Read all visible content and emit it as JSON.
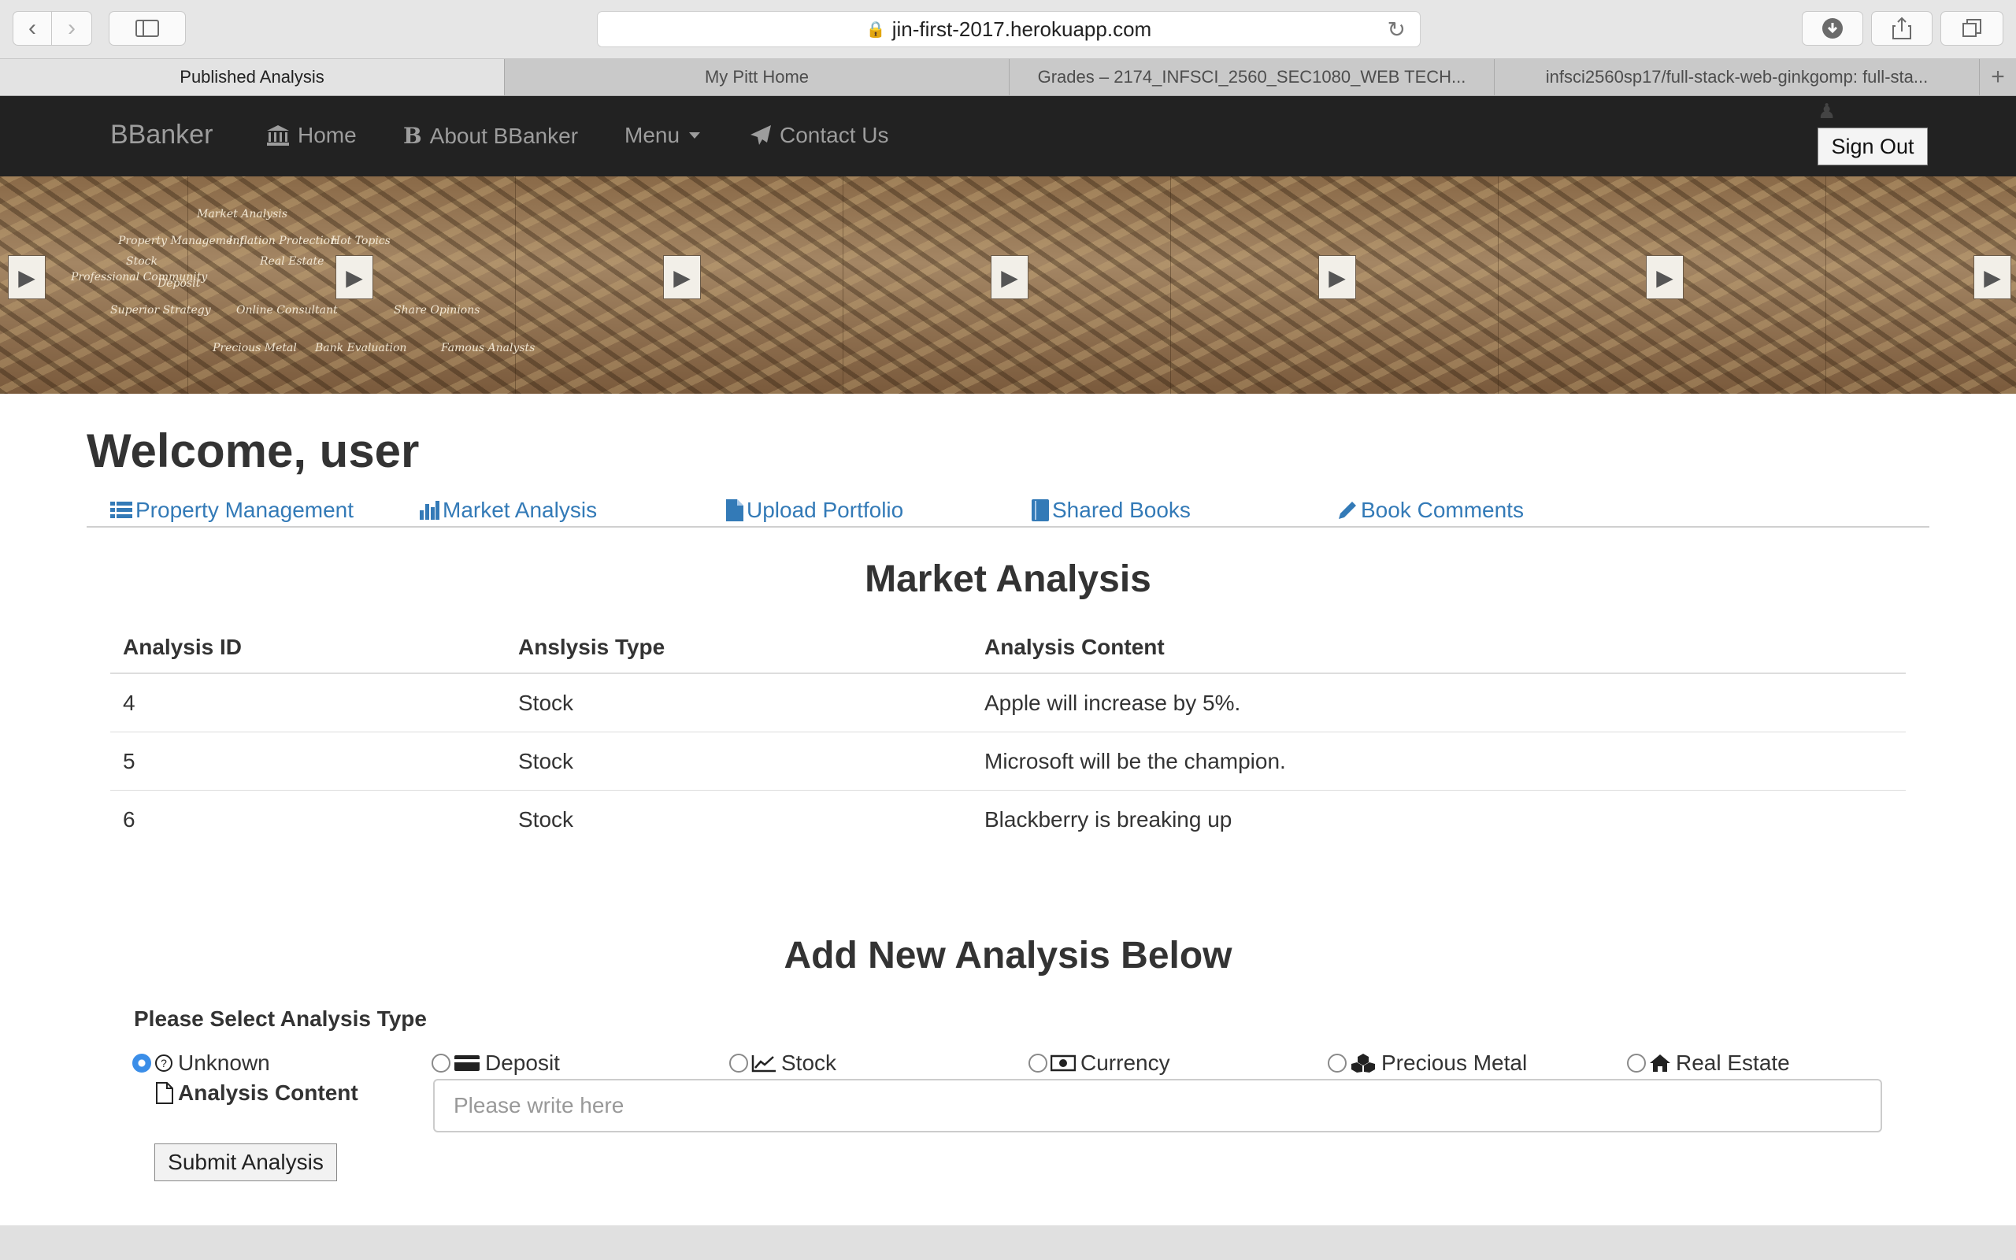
{
  "browser": {
    "url": "jin-first-2017.herokuapp.com",
    "tabs": [
      {
        "label": "Published Analysis",
        "active": true
      },
      {
        "label": "My Pitt Home",
        "active": false
      },
      {
        "label": "Grades – 2174_INFSCI_2560_SEC1080_WEB TECH...",
        "active": false
      },
      {
        "label": "infsci2560sp17/full-stack-web-ginkgomp: full-sta...",
        "active": false
      }
    ],
    "icons": {
      "back": "chevron-left-icon",
      "forward": "chevron-right-icon",
      "sidebar": "sidebar-icon",
      "lock": "lock-icon",
      "reload": "reload-icon",
      "download": "download-icon",
      "share": "share-icon",
      "tabs": "tabs-icon",
      "new_tab": "plus-icon"
    }
  },
  "navbar": {
    "brand": "BBanker",
    "items": [
      {
        "label": "Home",
        "icon": "bank-icon"
      },
      {
        "label": "About BBanker",
        "icon": "bold-b-icon"
      },
      {
        "label": "Menu",
        "icon": "caret-down-icon"
      },
      {
        "label": "Contact Us",
        "icon": "paper-plane-icon"
      }
    ],
    "sign_out": "Sign Out",
    "bg_color": "#222222",
    "text_color": "#9d9d9d"
  },
  "banner": {
    "words": [
      "Market Analysis",
      "Inflation Protection",
      "Hot Topics",
      "Property Management",
      "Stock",
      "Real Estate",
      "Professional Community",
      "Deposit",
      "Superior Strategy",
      "Online Consultant",
      "Share Opinions",
      "Precious Metal",
      "Bank Evaluation",
      "Famous Analysts"
    ],
    "logo_label": "BBanker"
  },
  "main": {
    "welcome": "Welcome, user",
    "subnav": [
      {
        "label": "Property Management",
        "icon": "list-icon"
      },
      {
        "label": "Market Analysis",
        "icon": "bar-chart-icon"
      },
      {
        "label": "Upload Portfolio",
        "icon": "file-icon"
      },
      {
        "label": "Shared Books",
        "icon": "book-icon"
      },
      {
        "label": "Book Comments",
        "icon": "pencil-icon"
      }
    ],
    "link_color": "#337ab7",
    "section_title": "Market Analysis",
    "table": {
      "headers": [
        "Analysis ID",
        "Anslysis Type",
        "Analysis Content"
      ],
      "rows": [
        [
          "4",
          "Stock",
          "Apple will increase by 5%."
        ],
        [
          "5",
          "Stock",
          "Microsoft will be the champion."
        ],
        [
          "6",
          "Stock",
          "Blackberry is breaking up"
        ]
      ]
    },
    "form": {
      "title": "Add New Analysis Below",
      "select_label": "Please Select Analysis Type",
      "options": [
        {
          "label": "Unknown",
          "icon": "question-circle-icon",
          "checked": true
        },
        {
          "label": "Deposit",
          "icon": "credit-card-icon",
          "checked": false
        },
        {
          "label": "Stock",
          "icon": "line-chart-icon",
          "checked": false
        },
        {
          "label": "Currency",
          "icon": "money-icon",
          "checked": false
        },
        {
          "label": "Precious Metal",
          "icon": "cubes-icon",
          "checked": false
        },
        {
          "label": "Real Estate",
          "icon": "home-icon",
          "checked": false
        }
      ],
      "content_label": "Analysis Content",
      "content_icon": "file-outline-icon",
      "placeholder": "Please write here",
      "submit": "Submit Analysis"
    }
  }
}
